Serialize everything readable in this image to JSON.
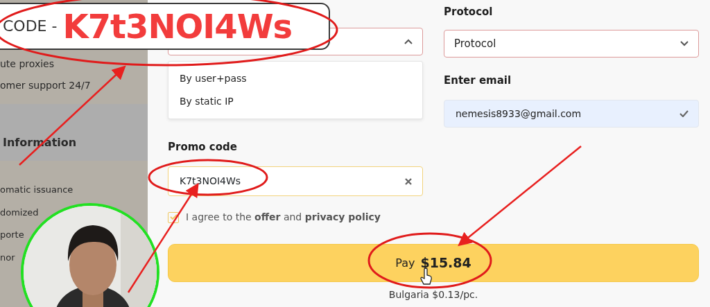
{
  "overlay": {
    "code_label": "CODE -",
    "code": "K7t3NOI4Ws"
  },
  "sidebar": {
    "items": [
      "ute proxies",
      "omer support 24/7"
    ],
    "section_title": "Information",
    "features": [
      "omatic issuance",
      "domized",
      "porte",
      "nor"
    ]
  },
  "form": {
    "auth_method": {
      "expanded": true,
      "options": [
        {
          "label": "By user+pass"
        },
        {
          "label": "By static IP"
        }
      ]
    },
    "protocol": {
      "label": "Protocol",
      "value": "Protocol",
      "expanded": false
    },
    "email": {
      "label": "Enter email",
      "value": "nemesis8933@gmail.com",
      "valid": true
    },
    "promo": {
      "label": "Promo code",
      "value": "K7t3NOI4Ws"
    },
    "agree": {
      "checked": true,
      "text_before": "I agree to the",
      "offer_link": "offer",
      "middle": "and",
      "policy_link": "privacy policy"
    },
    "pay": {
      "label": "Pay",
      "amount": "$15.84"
    },
    "price_note": "Bulgaria $0.13/pc."
  }
}
